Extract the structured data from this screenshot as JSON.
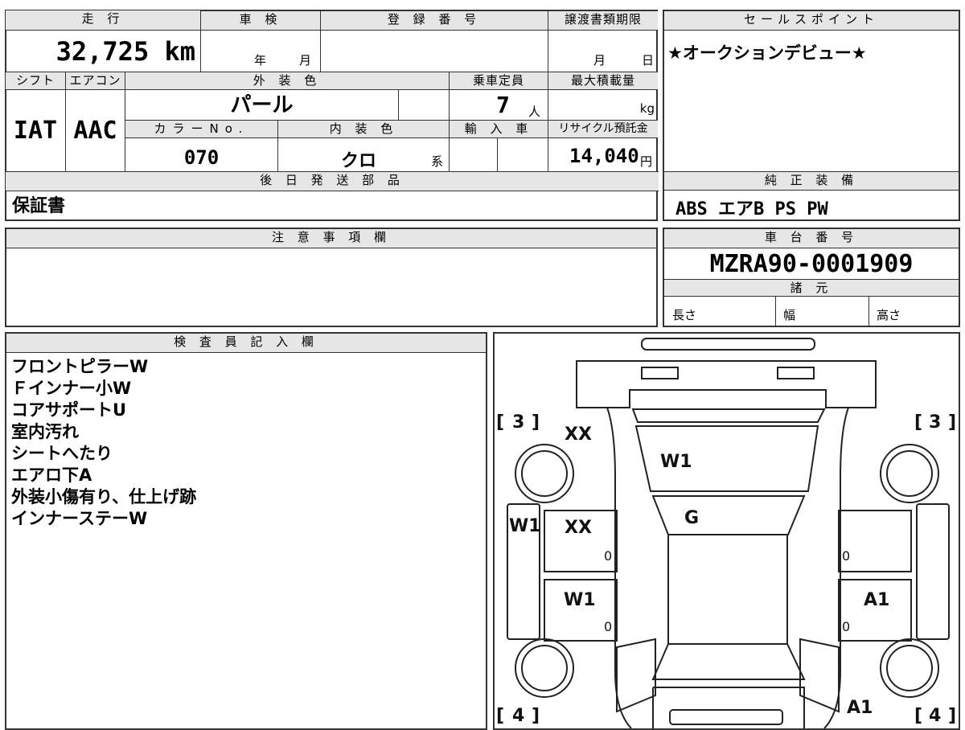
{
  "top_header": {
    "mileage_label": "走 行",
    "inspection_label": "車 検",
    "registration_label": "登 録 番 号",
    "transfer_deadline_label": "譲渡書類期限",
    "sales_points_label": "セールスポイント"
  },
  "mileage": "32,725 km",
  "inspection": {
    "year_unit": "年",
    "month_unit": "月"
  },
  "registration_number": "",
  "transfer_deadline": {
    "month_unit": "月",
    "day_unit": "日"
  },
  "sales_point_text": "★オークションデビュー★",
  "row2_header": {
    "shift_label": "シフト",
    "aircon_label": "エアコン",
    "exterior_color_label": "外 装 色",
    "capacity_label": "乗車定員",
    "max_load_label": "最大積載量"
  },
  "shift": "IAT",
  "aircon": "AAC",
  "exterior_color": "パール",
  "capacity": "7",
  "capacity_unit": "人",
  "max_load_unit": "kg",
  "row3_header": {
    "color_no_label": "カラーNo.",
    "interior_color_label": "内 装 色",
    "import_label": "輸 入 車",
    "recycle_label": "リサイクル預託金"
  },
  "color_no": "070",
  "interior_color": "クロ",
  "interior_color_suffix": "系",
  "recycle_fee": "14,040",
  "recycle_unit": "円",
  "later_parts_label": "後 日 発 送 部 品",
  "later_parts": "保証書",
  "genuine_equipment_label": "純 正 装 備",
  "genuine_equipment": "ABS エアB PS PW",
  "notes_label": "注 意 事 項 欄",
  "chassis_number_label": "車 台 番 号",
  "chassis_number": "MZRA90-0001909",
  "specs_label": "諸 元",
  "specs": {
    "length_label": "長さ",
    "width_label": "幅",
    "height_label": "高さ"
  },
  "inspector_label": "検 査 員 記 入 欄",
  "inspector_notes": [
    "フロントピラーW",
    "Ｆインナー小W",
    "コアサポートU",
    "室内汚れ",
    "シートへたり",
    "エアロ下A",
    "外装小傷有り、仕上げ跡",
    "インナーステーW"
  ],
  "diagram_marks": {
    "tire_front_left": "3",
    "tire_front_right": "3",
    "tire_rear_left": "4",
    "tire_rear_right": "4",
    "front_left_fender": "XX",
    "hood": "W1",
    "windshield": "G",
    "left_pillar": "W1",
    "left_front_door": "XX",
    "left_rear_door": "W1",
    "right_rear_door": "A1",
    "rear_right": "A1",
    "door_mark_lf": "0",
    "door_mark_lr": "0",
    "door_mark_rf": "0",
    "door_mark_rr": "0"
  }
}
